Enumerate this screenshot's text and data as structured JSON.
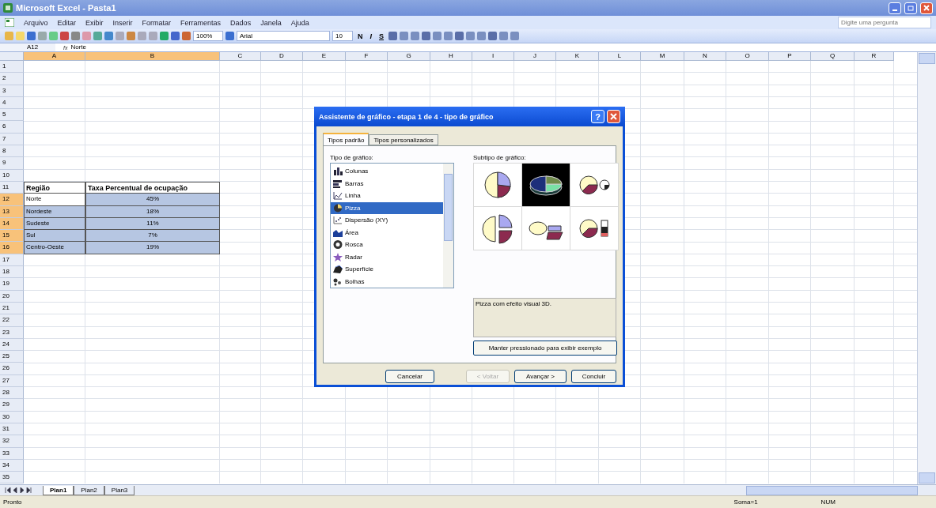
{
  "window": {
    "title": "Microsoft Excel - Pasta1"
  },
  "menu": [
    "Arquivo",
    "Editar",
    "Exibir",
    "Inserir",
    "Formatar",
    "Ferramentas",
    "Dados",
    "Janela",
    "Ajuda"
  ],
  "help_box": {
    "placeholder": "Digite uma pergunta"
  },
  "toolbar": {
    "zoom": "100%",
    "font": "Arial",
    "size": "10",
    "styles": [
      "N",
      "I",
      "S"
    ]
  },
  "formula_bar": {
    "name_box": "A12",
    "fx": "fx",
    "value": "Norte"
  },
  "columns": [
    {
      "label": "A",
      "selected": true
    },
    {
      "label": "B",
      "selected": true
    },
    {
      "label": "C",
      "selected": false
    },
    {
      "label": "D",
      "selected": false
    },
    {
      "label": "E",
      "selected": false
    },
    {
      "label": "F",
      "selected": false
    },
    {
      "label": "G",
      "selected": false
    },
    {
      "label": "H",
      "selected": false
    },
    {
      "label": "I",
      "selected": false
    },
    {
      "label": "J",
      "selected": false
    },
    {
      "label": "K",
      "selected": false
    },
    {
      "label": "L",
      "selected": false
    },
    {
      "label": "M",
      "selected": false
    },
    {
      "label": "N",
      "selected": false
    },
    {
      "label": "O",
      "selected": false
    },
    {
      "label": "P",
      "selected": false
    },
    {
      "label": "Q",
      "selected": false
    },
    {
      "label": "R",
      "selected": false
    }
  ],
  "rows": [
    {
      "label": "1",
      "selected": false
    },
    {
      "label": "2",
      "selected": false
    },
    {
      "label": "3",
      "selected": false
    },
    {
      "label": "4",
      "selected": false
    },
    {
      "label": "5",
      "selected": false
    },
    {
      "label": "6",
      "selected": false
    },
    {
      "label": "7",
      "selected": false
    },
    {
      "label": "8",
      "selected": false
    },
    {
      "label": "9",
      "selected": false
    },
    {
      "label": "10",
      "selected": false
    },
    {
      "label": "11",
      "selected": false,
      "kind": "header",
      "cells": [
        {
          "text": "Região",
          "highlighted": false
        },
        {
          "text": "Taxa Percentual de ocupação",
          "highlighted": false
        }
      ]
    },
    {
      "label": "12",
      "selected": true,
      "kind": "data",
      "cells": [
        {
          "text": "Norte",
          "highlighted": false
        },
        {
          "text": "45%",
          "highlighted": true
        }
      ]
    },
    {
      "label": "13",
      "selected": true,
      "kind": "data",
      "cells": [
        {
          "text": "Nordeste",
          "highlighted": true
        },
        {
          "text": "18%",
          "highlighted": true
        }
      ]
    },
    {
      "label": "14",
      "selected": true,
      "kind": "data",
      "cells": [
        {
          "text": "Sudeste",
          "highlighted": true
        },
        {
          "text": "11%",
          "highlighted": true
        }
      ]
    },
    {
      "label": "15",
      "selected": true,
      "kind": "data",
      "cells": [
        {
          "text": "Sul",
          "highlighted": true
        },
        {
          "text": "7%",
          "highlighted": true
        }
      ]
    },
    {
      "label": "16",
      "selected": true,
      "kind": "data",
      "cells": [
        {
          "text": "Centro-Oeste",
          "highlighted": true
        },
        {
          "text": "19%",
          "highlighted": true
        }
      ]
    },
    {
      "label": "17",
      "selected": false
    },
    {
      "label": "18",
      "selected": false
    },
    {
      "label": "19",
      "selected": false
    },
    {
      "label": "20",
      "selected": false
    },
    {
      "label": "21",
      "selected": false
    },
    {
      "label": "22",
      "selected": false
    },
    {
      "label": "23",
      "selected": false
    },
    {
      "label": "24",
      "selected": false
    },
    {
      "label": "25",
      "selected": false
    },
    {
      "label": "26",
      "selected": false
    },
    {
      "label": "27",
      "selected": false
    },
    {
      "label": "28",
      "selected": false
    },
    {
      "label": "29",
      "selected": false
    },
    {
      "label": "30",
      "selected": false
    },
    {
      "label": "31",
      "selected": false
    },
    {
      "label": "32",
      "selected": false
    },
    {
      "label": "33",
      "selected": false
    },
    {
      "label": "34",
      "selected": false
    },
    {
      "label": "35",
      "selected": false
    }
  ],
  "sheet_tabs": [
    {
      "label": "Plan1",
      "selected": true
    },
    {
      "label": "Plan2",
      "selected": false
    },
    {
      "label": "Plan3",
      "selected": false
    }
  ],
  "status_bar": {
    "left": "Pronto",
    "sum": "Soma=1",
    "num": "NUM"
  },
  "dialog": {
    "title": "Assistente de gráfico - etapa 1 de 4 - tipo de gráfico",
    "help": "?",
    "tabs": [
      {
        "label": "Tipos padrão",
        "selected": true
      },
      {
        "label": "Tipos personalizados",
        "selected": false
      }
    ],
    "type_label": "Tipo de gráfico:",
    "types": [
      {
        "label": "Colunas",
        "kind": "column",
        "selected": false
      },
      {
        "label": "Barras",
        "kind": "bar",
        "selected": false
      },
      {
        "label": "Linha",
        "kind": "line",
        "selected": false
      },
      {
        "label": "Pizza",
        "kind": "pie",
        "selected": true
      },
      {
        "label": "Dispersão (XY)",
        "kind": "scatter",
        "selected": false
      },
      {
        "label": "Área",
        "kind": "area",
        "selected": false
      },
      {
        "label": "Rosca",
        "kind": "donut",
        "selected": false
      },
      {
        "label": "Radar",
        "kind": "radar",
        "selected": false
      },
      {
        "label": "Superfície",
        "kind": "surface",
        "selected": false
      },
      {
        "label": "Bolhas",
        "kind": "bubble",
        "selected": false
      }
    ],
    "subtype_label": "Subtipo de gráfico:",
    "subtypes": [
      {
        "kind": "pie",
        "selected": false
      },
      {
        "kind": "pie3d",
        "selected": true
      },
      {
        "kind": "pie_of_pie",
        "selected": false
      },
      {
        "kind": "exploded",
        "selected": false
      },
      {
        "kind": "exploded3d",
        "selected": false
      },
      {
        "kind": "bar_of_pie",
        "selected": false
      }
    ],
    "description": "Pizza com efeito visual 3D.",
    "preview_button": "Manter pressionado para exibir exemplo",
    "buttons": [
      {
        "label": "Cancelar",
        "disabled": false
      },
      {
        "label": "< Voltar",
        "disabled": true
      },
      {
        "label": "Avançar >",
        "disabled": false
      },
      {
        "label": "Concluir",
        "disabled": false
      }
    ]
  }
}
